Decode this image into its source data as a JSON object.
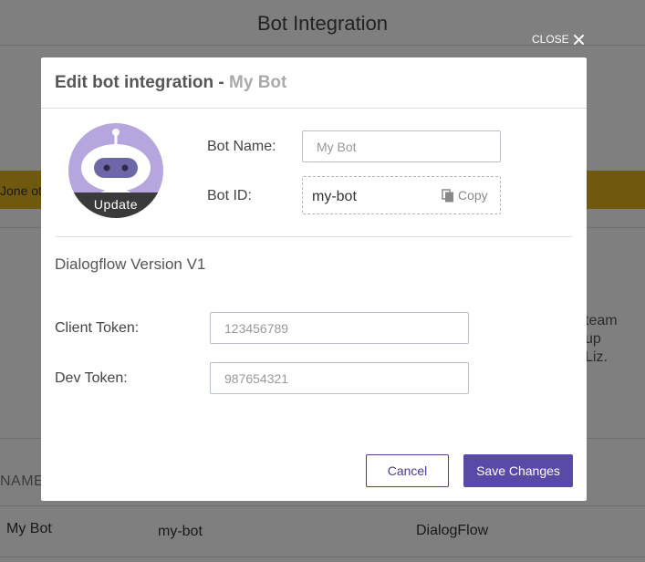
{
  "background": {
    "page_title": "Bot Integration",
    "banner_text": "Jone ot",
    "side_text": [
      "team",
      "up",
      "Liz."
    ],
    "table": {
      "column_header": "NAME",
      "row": {
        "name": "My Bot",
        "id": "my-bot",
        "type": "DialogFlow"
      }
    }
  },
  "overlay": {
    "close_label": "CLOSE",
    "close_icon": "close-icon"
  },
  "modal": {
    "title_prefix": "Edit bot integration - ",
    "title_bot_name": "My Bot",
    "avatar": {
      "icon": "robot-icon",
      "update_label": "Update",
      "color": "#b5a6de"
    },
    "bot_name": {
      "label": "Bot Name:",
      "placeholder": "My Bot"
    },
    "bot_id": {
      "label": "Bot ID:",
      "value": "my-bot",
      "copy_label": "Copy",
      "copy_icon": "copy-icon"
    },
    "section_title": "Dialogflow Version V1",
    "client_token": {
      "label": "Client Token:",
      "placeholder": "123456789"
    },
    "dev_token": {
      "label": "Dev Token:",
      "placeholder": "987654321"
    },
    "cancel_label": "Cancel",
    "save_label": "Save Changes",
    "accent_color": "#5a4aa8"
  }
}
